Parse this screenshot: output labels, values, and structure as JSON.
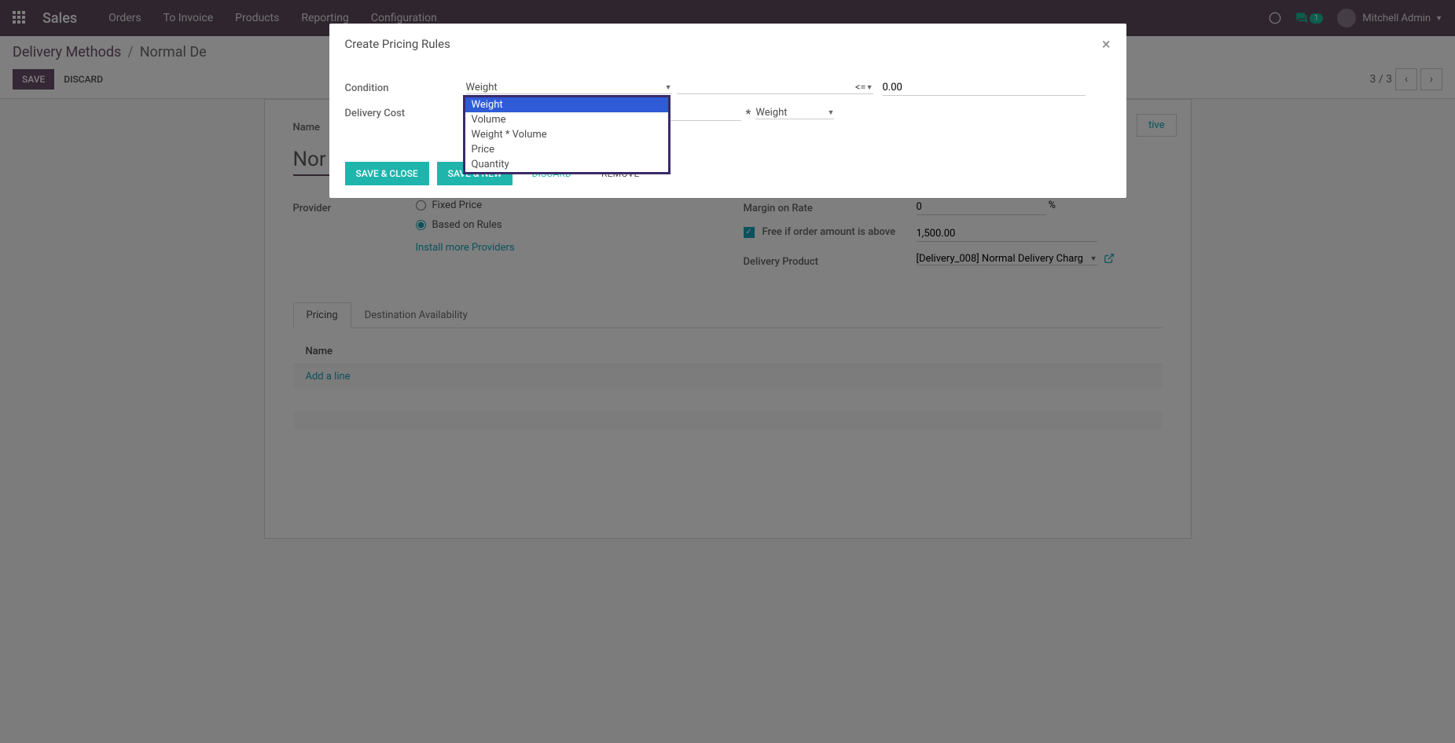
{
  "navbar": {
    "brand": "Sales",
    "links": [
      "Orders",
      "To Invoice",
      "Products",
      "Reporting",
      "Configuration"
    ],
    "chat_count": "1",
    "user": "Mitchell Admin"
  },
  "breadcrumb": {
    "parent": "Delivery Methods",
    "current": "Normal De"
  },
  "control": {
    "save": "Save",
    "discard": "Discard",
    "pager": "3 / 3"
  },
  "form": {
    "status_btn": "tive",
    "name_label": "Name",
    "name_value": "Nor",
    "provider_label": "Provider",
    "provider_fixed": "Fixed Price",
    "provider_rules": "Based on Rules",
    "install_link": "Install more Providers",
    "margin_label": "Margin on Rate",
    "margin_value": "0",
    "margin_suffix": "%",
    "free_label": "Free if order amount is above",
    "free_value": "1,500.00",
    "delivery_product_label": "Delivery Product",
    "delivery_product_value": "[Delivery_008] Normal Delivery Charg",
    "tabs": {
      "pricing": "Pricing",
      "dest": "Destination Availability"
    },
    "table_header": "Name",
    "add_line": "Add a line"
  },
  "modal": {
    "title": "Create Pricing Rules",
    "condition_label": "Condition",
    "condition_field": "Weight",
    "operator": "<=",
    "condition_value": "0.00",
    "cost_label": "Delivery Cost",
    "star": "*",
    "cost_unit": "Weight",
    "options": [
      "Weight",
      "Volume",
      "Weight * Volume",
      "Price",
      "Quantity"
    ],
    "save_close": "Save & Close",
    "save_new": "Save & New",
    "discard": "Discard",
    "remove": "Remove"
  }
}
